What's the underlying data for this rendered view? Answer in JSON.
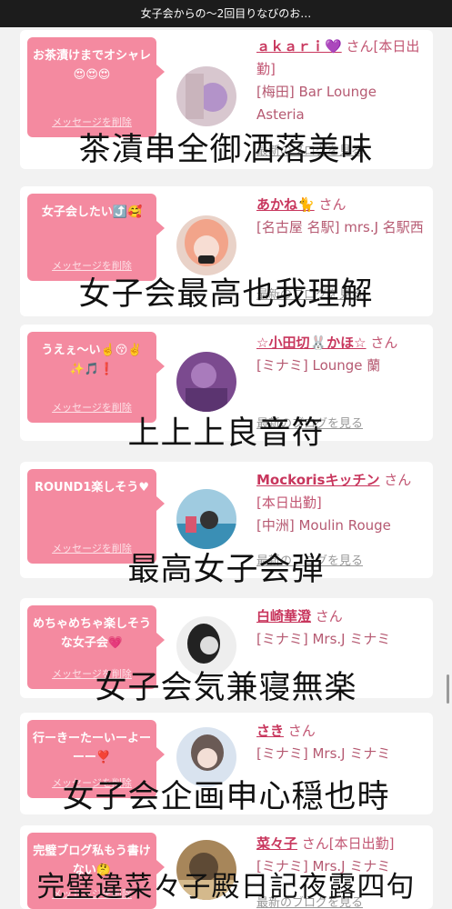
{
  "header": {
    "title": "女子会からの〜2回目りなびのお…"
  },
  "common": {
    "delete_label": "メッセージを削除",
    "blog_label": "最新のブログを見る"
  },
  "posts": [
    {
      "message": "お茶漬けまでオシャレ😍😍😍",
      "name": "ａｋａｒｉ💜",
      "honorific": "さん[本日出勤]",
      "shop": "[梅田] Bar Lounge Asteria",
      "caption": "茶漬串全御洒落美味"
    },
    {
      "message": "女子会したい⤴️🥰",
      "name": "あかね🐈",
      "honorific": "さん",
      "shop": "[名古屋 名駅] mrs.J 名駅西",
      "caption": "女子会最高也我理解"
    },
    {
      "message": "うえぇ〜い☝️😚✌️✨🎵❗",
      "name": "☆小田切🐰かほ☆",
      "honorific": "さん",
      "shop": "[ミナミ] Lounge 蘭",
      "caption": "上上上良音符"
    },
    {
      "message": "ROUND1楽しそう♥",
      "name": "Mockorisキッチン",
      "honorific": "さん[本日出勤]",
      "shop": "[中洲] Moulin Rouge",
      "caption": "最高女子会弾"
    },
    {
      "message": "めちゃめちゃ楽しそうな女子会💗",
      "name": "白崎華澄",
      "honorific": "さん",
      "shop": "[ミナミ] Mrs.J ミナミ",
      "caption": "女子会気兼寝無楽"
    },
    {
      "message": "行ーきーたーいーよーーー❣️",
      "name": "さき",
      "honorific": "さん",
      "shop": "[ミナミ] Mrs.J ミナミ",
      "caption": "女子会企画申心穏也時"
    },
    {
      "message": "完璧ブログ私もう書けない🤔",
      "name": "菜々子",
      "honorific": "さん[本日出勤]",
      "shop": "[ミナミ] Mrs.J ミナミ",
      "caption": "完璧違菜々子殿日記夜露四句"
    }
  ]
}
